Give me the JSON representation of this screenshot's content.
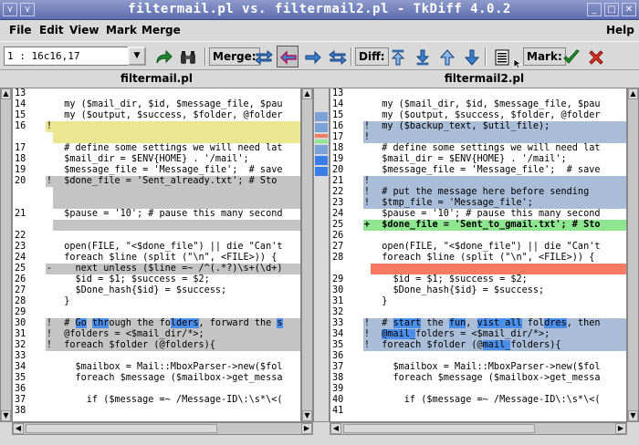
{
  "window": {
    "title": "filtermail.pl vs. filtermail2.pl - TkDiff 4.0.2",
    "btn_left1": "⋎",
    "btn_left2": "⋎",
    "btn_min": "_",
    "btn_max": "□",
    "btn_close": "✕"
  },
  "menus": {
    "file": "File",
    "edit": "Edit",
    "view": "View",
    "mark": "Mark",
    "merge": "Merge",
    "help": "Help"
  },
  "toolbar": {
    "diff_select_value": "1    : 16c16,17",
    "merge_label": "Merge:",
    "diff_label": "Diff:",
    "mark_label": "Mark:"
  },
  "colors": {
    "changed": "#a9bcd8",
    "deleted": "#c4c4c4",
    "yellow": "#ece592",
    "added": "#8fe690",
    "removed": "#f77b62",
    "highlight": "#4a8ee9"
  },
  "left_file": {
    "name": "filtermail.pl",
    "lines": [
      {
        "n": "13",
        "m": "",
        "t": "",
        "c": ""
      },
      {
        "n": "14",
        "m": "",
        "t": "  my ($mail_dir, $id, $message_file, $pau",
        "c": ""
      },
      {
        "n": "15",
        "m": "",
        "t": "  my ($output, $success, $folder, @folder",
        "c": ""
      },
      {
        "n": "16",
        "m": "!",
        "t": "",
        "c": "yellow"
      },
      {
        "n": "",
        "m": "",
        "t": "",
        "c": "yellow"
      },
      {
        "n": "17",
        "m": "",
        "t": "  # define some settings we will need lat",
        "c": ""
      },
      {
        "n": "18",
        "m": "",
        "t": "  $mail_dir = $ENV{HOME} . '/mail';",
        "c": ""
      },
      {
        "n": "19",
        "m": "",
        "t": "  $message_file = 'Message_file';  # save",
        "c": ""
      },
      {
        "n": "20",
        "m": "!",
        "t": "  $done_file = 'Sent_already.txt'; # Sto",
        "c": "gray"
      },
      {
        "n": "",
        "m": "",
        "t": "",
        "c": "gray"
      },
      {
        "n": "",
        "m": "",
        "t": "",
        "c": "gray"
      },
      {
        "n": "21",
        "m": "",
        "t": "  $pause = '10'; # pause this many second",
        "c": ""
      },
      {
        "n": "",
        "m": "",
        "t": "",
        "c": "gray"
      },
      {
        "n": "22",
        "m": "",
        "t": "",
        "c": ""
      },
      {
        "n": "23",
        "m": "",
        "t": "  open(FILE, \"<$done_file\") || die \"Can't",
        "c": ""
      },
      {
        "n": "24",
        "m": "",
        "t": "  foreach $line (split (\"\\n\", <FILE>)) {",
        "c": ""
      },
      {
        "n": "25",
        "m": "-",
        "t": "    next unless ($line =~ /^(.*?)\\s+(\\d+)",
        "c": "gray"
      },
      {
        "n": "26",
        "m": "",
        "t": "    $id = $1; $success = $2;",
        "c": ""
      },
      {
        "n": "27",
        "m": "",
        "t": "    $Done_hash{$id} = $success;",
        "c": ""
      },
      {
        "n": "28",
        "m": "",
        "t": "  }",
        "c": ""
      },
      {
        "n": "29",
        "m": "",
        "t": "",
        "c": ""
      },
      {
        "n": "30",
        "m": "!",
        "t": "",
        "c": "gray",
        "segs": [
          {
            "t": "  # ",
            "h": false
          },
          {
            "t": "Go",
            "h": true
          },
          {
            "t": " ",
            "h": false
          },
          {
            "t": "thr",
            "h": true
          },
          {
            "t": "ough the fo",
            "h": false
          },
          {
            "t": "lders",
            "h": true
          },
          {
            "t": ", fo",
            "h": false
          },
          {
            "t": "rward",
            "h": false
          },
          {
            "t": " the ",
            "h": false
          },
          {
            "t": "s",
            "h": true
          }
        ]
      },
      {
        "n": "31",
        "m": "!",
        "t": "  @folders = <$mail_dir/*>;",
        "c": "gray"
      },
      {
        "n": "32",
        "m": "!",
        "t": "  foreach $folder (@folders){",
        "c": "gray"
      },
      {
        "n": "33",
        "m": "",
        "t": "",
        "c": ""
      },
      {
        "n": "34",
        "m": "",
        "t": "    $mailbox = Mail::MboxParser->new($fol",
        "c": ""
      },
      {
        "n": "35",
        "m": "",
        "t": "    foreach $message ($mailbox->get_messa",
        "c": ""
      },
      {
        "n": "36",
        "m": "",
        "t": "",
        "c": ""
      },
      {
        "n": "37",
        "m": "",
        "t": "      if ($message =~ /Message-ID\\:\\s*\\<(",
        "c": ""
      },
      {
        "n": "38",
        "m": "",
        "t": "",
        "c": ""
      }
    ]
  },
  "right_file": {
    "name": "filtermail2.pl",
    "lines": [
      {
        "n": "13",
        "m": "",
        "t": "",
        "c": ""
      },
      {
        "n": "14",
        "m": "",
        "t": "  my ($mail_dir, $id, $message_file, $pau",
        "c": ""
      },
      {
        "n": "15",
        "m": "",
        "t": "  my ($output, $success, $folder, @folder",
        "c": ""
      },
      {
        "n": "16",
        "m": "!",
        "t": "  my ($backup_text, $util_file);",
        "c": "blue"
      },
      {
        "n": "17",
        "m": "!",
        "t": "",
        "c": "blue"
      },
      {
        "n": "18",
        "m": "",
        "t": "  # define some settings we will need lat",
        "c": ""
      },
      {
        "n": "19",
        "m": "",
        "t": "  $mail_dir = $ENV{HOME} . '/mail';",
        "c": ""
      },
      {
        "n": "20",
        "m": "",
        "t": "  $message_file = 'Message_file';  # save",
        "c": ""
      },
      {
        "n": "21",
        "m": "!",
        "t": "",
        "c": "blue"
      },
      {
        "n": "22",
        "m": "!",
        "t": "  # put the message here before sending",
        "c": "blue"
      },
      {
        "n": "23",
        "m": "!",
        "t": "  $tmp_file = 'Message_file';",
        "c": "blue"
      },
      {
        "n": "24",
        "m": "",
        "t": "  $pause = '10'; # pause this many second",
        "c": ""
      },
      {
        "n": "25",
        "m": "+",
        "t": "  $done_file = 'Sent_to_gmail.txt'; # Sto",
        "c": "green"
      },
      {
        "n": "26",
        "m": "",
        "t": "",
        "c": ""
      },
      {
        "n": "27",
        "m": "",
        "t": "  open(FILE, \"<$done_file\") || die \"Can't",
        "c": ""
      },
      {
        "n": "28",
        "m": "",
        "t": "  foreach $line (split (\"\\n\", <FILE>)) {",
        "c": ""
      },
      {
        "n": "",
        "m": "",
        "t": "",
        "c": "red"
      },
      {
        "n": "29",
        "m": "",
        "t": "    $id = $1; $success = $2;",
        "c": ""
      },
      {
        "n": "30",
        "m": "",
        "t": "    $Done_hash{$id} = $success;",
        "c": ""
      },
      {
        "n": "31",
        "m": "",
        "t": "  }",
        "c": ""
      },
      {
        "n": "32",
        "m": "",
        "t": "",
        "c": ""
      },
      {
        "n": "33",
        "m": "!",
        "t": "",
        "c": "blue",
        "segs": [
          {
            "t": "  # ",
            "h": false
          },
          {
            "t": "start",
            "h": true
          },
          {
            "t": " the ",
            "h": false
          },
          {
            "t": "fun",
            "h": true
          },
          {
            "t": ", ",
            "h": false
          },
          {
            "t": "vist all",
            "h": true
          },
          {
            "t": " fol",
            "h": false
          },
          {
            "t": "dres",
            "h": true
          },
          {
            "t": ", then",
            "h": false
          }
        ]
      },
      {
        "n": "34",
        "m": "!",
        "t": "",
        "c": "blue",
        "segs": [
          {
            "t": "  ",
            "h": false
          },
          {
            "t": "@mail_",
            "h": true
          },
          {
            "t": "folders = <$mail_dir/*>;",
            "h": false
          }
        ]
      },
      {
        "n": "35",
        "m": "!",
        "t": "",
        "c": "blue",
        "segs": [
          {
            "t": "  foreach $folder (@",
            "h": false
          },
          {
            "t": "mail_",
            "h": true
          },
          {
            "t": "folders){",
            "h": false
          }
        ]
      },
      {
        "n": "36",
        "m": "",
        "t": "",
        "c": ""
      },
      {
        "n": "37",
        "m": "",
        "t": "    $mailbox = Mail::MboxParser->new($fol",
        "c": ""
      },
      {
        "n": "38",
        "m": "",
        "t": "    foreach $message ($mailbox->get_messa",
        "c": ""
      },
      {
        "n": "39",
        "m": "",
        "t": "",
        "c": ""
      },
      {
        "n": "40",
        "m": "",
        "t": "      if ($message =~ /Message-ID\\:\\s*\\<(",
        "c": ""
      },
      {
        "n": "41",
        "m": "",
        "t": "",
        "c": ""
      }
    ]
  }
}
